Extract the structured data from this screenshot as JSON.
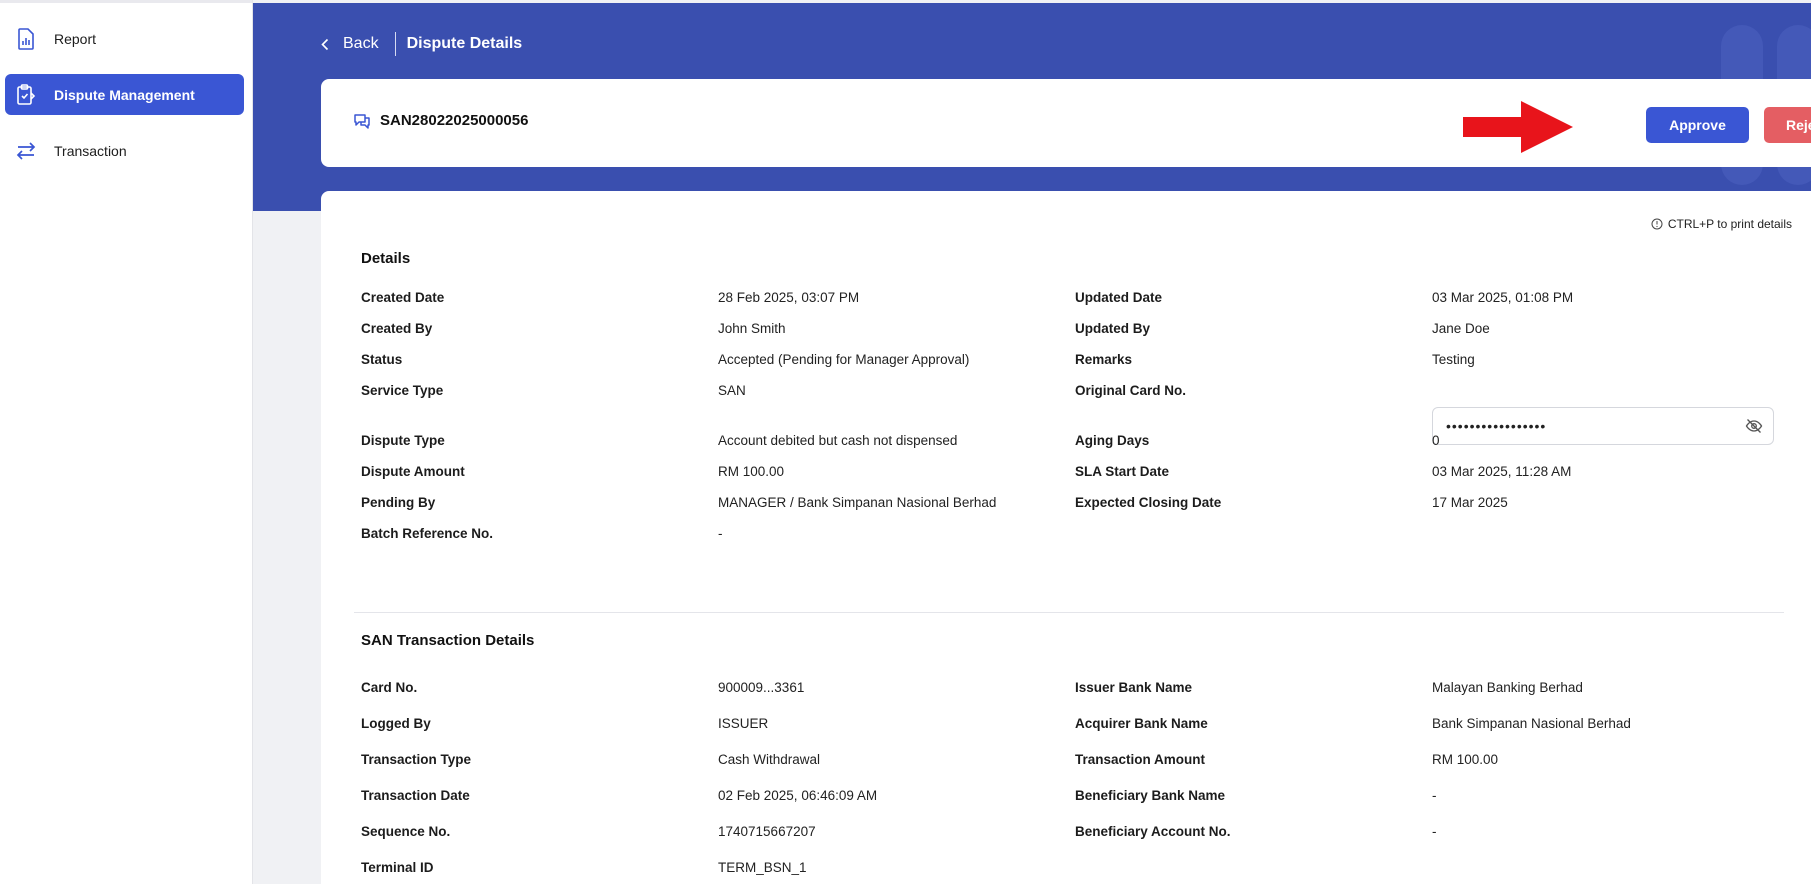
{
  "sidebar": {
    "items": [
      {
        "label": "Report",
        "icon": "report-icon",
        "active": false
      },
      {
        "label": "Dispute Management",
        "icon": "clipboard-icon",
        "active": true
      },
      {
        "label": "Transaction",
        "icon": "transfer-arrows-icon",
        "active": false
      }
    ]
  },
  "header": {
    "back_label": "Back",
    "title": "Dispute Details"
  },
  "dispute": {
    "id": "SAN28022025000056",
    "approve_label": "Approve",
    "reject_label": "Reject"
  },
  "print_hint": "CTRL+P to print details",
  "details": {
    "title": "Details",
    "rows": [
      {
        "l1": "Created Date",
        "v1": "28 Feb 2025, 03:07 PM",
        "l2": "Updated Date",
        "v2": "03 Mar 2025, 01:08 PM"
      },
      {
        "l1": "Created By",
        "v1": "John Smith",
        "l2": "Updated By",
        "v2": "Jane Doe"
      },
      {
        "l1": "Status",
        "v1": "Accepted (Pending for Manager Approval)",
        "l2": "Remarks",
        "v2": "Testing"
      },
      {
        "l1": "Service Type",
        "v1": "SAN",
        "l2": "Original Card No.",
        "v2": "•••••••••••••••••"
      },
      {
        "l1": "Dispute Type",
        "v1": "Account debited but cash not dispensed",
        "l2": "Aging Days",
        "v2": "0"
      },
      {
        "l1": "Dispute Amount",
        "v1": "RM 100.00",
        "l2": "SLA Start Date",
        "v2": "03 Mar 2025, 11:28 AM"
      },
      {
        "l1": "Pending By",
        "v1": "MANAGER / Bank Simpanan Nasional Berhad",
        "l2": "Expected Closing Date",
        "v2": "17 Mar 2025"
      },
      {
        "l1": "Batch Reference No.",
        "v1": "-",
        "l2": "",
        "v2": ""
      }
    ]
  },
  "transaction": {
    "title": "SAN Transaction Details",
    "rows": [
      {
        "l1": "Card No.",
        "v1": "900009...3361",
        "l2": "Issuer Bank Name",
        "v2": "Malayan Banking Berhad"
      },
      {
        "l1": "Logged By",
        "v1": "ISSUER",
        "l2": "Acquirer Bank Name",
        "v2": "Bank Simpanan Nasional Berhad"
      },
      {
        "l1": "Transaction Type",
        "v1": "Cash Withdrawal",
        "l2": "Transaction Amount",
        "v2": "RM 100.00"
      },
      {
        "l1": "Transaction Date",
        "v1": "02 Feb 2025, 06:46:09 AM",
        "l2": "Beneficiary Bank Name",
        "v2": "-"
      },
      {
        "l1": "Sequence No.",
        "v1": "1740715667207",
        "l2": "Beneficiary Account No.",
        "v2": "-"
      },
      {
        "l1": "Terminal ID",
        "v1": "TERM_BSN_1",
        "l2": "",
        "v2": ""
      }
    ]
  },
  "colors": {
    "primary": "#3a56d4",
    "banner": "#3a4faf",
    "reject": "#e45e63",
    "annotation_arrow": "#e8141b"
  }
}
